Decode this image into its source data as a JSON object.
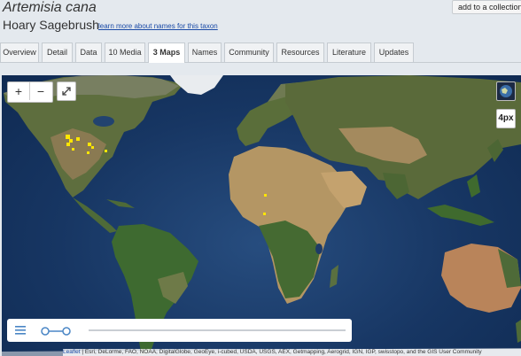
{
  "header": {
    "scientific_name": "Artemisia cana",
    "common_name": "Hoary Sagebrush",
    "learn_more_link": "learn more about names for this taxon",
    "add_to_collection": "add to a collection"
  },
  "tabs": [
    {
      "label": "Overview"
    },
    {
      "label": "Detail"
    },
    {
      "label": "Data"
    },
    {
      "label": "10 Media"
    },
    {
      "label": "3 Maps",
      "active": true
    },
    {
      "label": "Names"
    },
    {
      "label": "Community"
    },
    {
      "label": "Resources"
    },
    {
      "label": "Literature"
    },
    {
      "label": "Updates"
    }
  ],
  "map": {
    "zoom_in": "+",
    "zoom_out": "−",
    "fullscreen_icon": "expand-icon",
    "basemap_icon": "satellite-basemap-icon",
    "point_size_label": "4px",
    "layers_icon": "layers-icon",
    "attribution_leaflet": "Leaflet",
    "attribution_text": "| Esri, DeLorme, FAO, NOAA, DigitalGlobe, GeoEye, i-cubed, USDA, USGS, AEX, Getmapping, Aerogrid, IGN, IGP, swisstopo, and the GIS User Community",
    "colors": {
      "occurrence": "#ffe600",
      "ocean": "#173663",
      "land": "#5a6f3c"
    }
  }
}
